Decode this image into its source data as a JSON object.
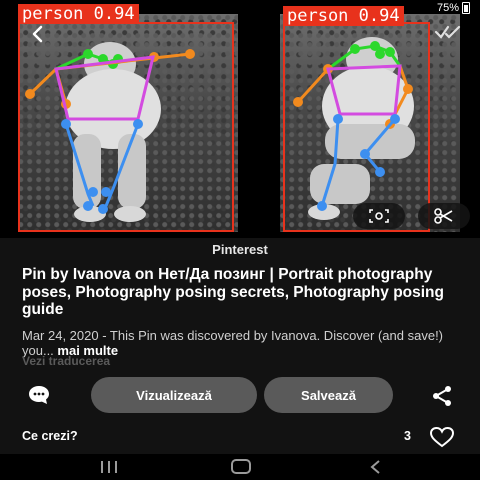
{
  "status_bar": {
    "battery": "75%"
  },
  "detections": [
    {
      "label": "person 0.94"
    },
    {
      "label": "person 0.94"
    }
  ],
  "image_controls": {
    "back_icon": "chevron-left-icon",
    "check_icon": "checkmarks-icon",
    "lens_icon": "visual-search-icon",
    "scissor_icon": "scissors-icon"
  },
  "pin": {
    "source": "Pinterest",
    "title": "Pin by Ivanova on Нет/Да  позинг | Portrait photography poses, Photography posing secrets, Photography posing guide",
    "description": "Mar 24, 2020 - This Pin was discovered by Ivanova. Discover (and save!) you...",
    "more_label": "mai multe",
    "translate_label": "Vezi traducerea"
  },
  "actions": {
    "view_label": "Vizualizează",
    "save_label": "Salvează"
  },
  "comments": {
    "prompt": "Ce crezi?",
    "like_count": "3"
  },
  "colors": {
    "detection_box": "#e8321c",
    "keypoint_face": "#2bd82b",
    "keypoint_arm": "#f28a1e",
    "keypoint_torso": "#d34be0",
    "keypoint_leg": "#3d8ff0",
    "pill_button": "#5a5a5a",
    "panel_bg": "#121212"
  }
}
